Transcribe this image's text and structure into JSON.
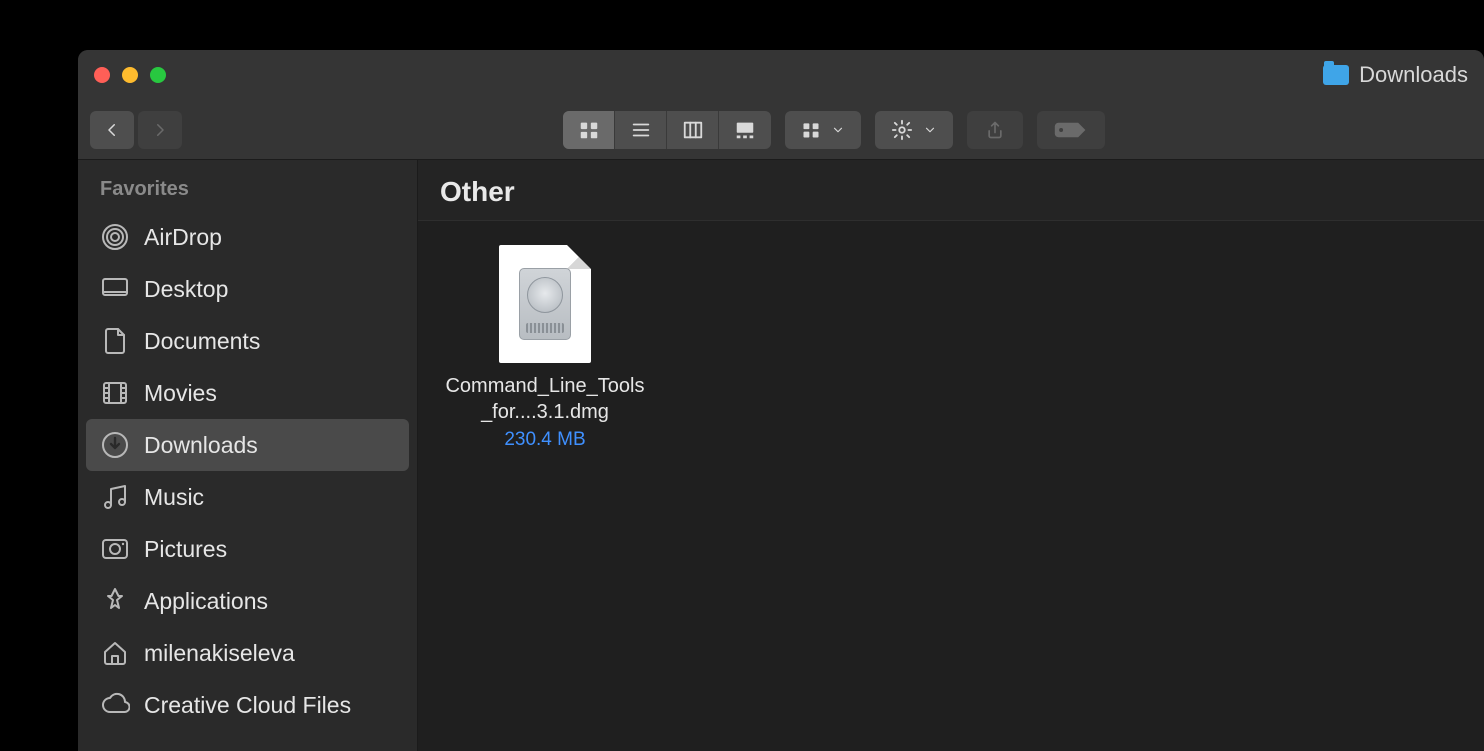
{
  "window": {
    "title": "Downloads"
  },
  "sidebar": {
    "heading": "Favorites",
    "items": [
      {
        "label": "AirDrop",
        "icon": "airdrop-icon",
        "selected": false
      },
      {
        "label": "Desktop",
        "icon": "desktop-icon",
        "selected": false
      },
      {
        "label": "Documents",
        "icon": "documents-icon",
        "selected": false
      },
      {
        "label": "Movies",
        "icon": "movies-icon",
        "selected": false
      },
      {
        "label": "Downloads",
        "icon": "downloads-icon",
        "selected": true
      },
      {
        "label": "Music",
        "icon": "music-icon",
        "selected": false
      },
      {
        "label": "Pictures",
        "icon": "pictures-icon",
        "selected": false
      },
      {
        "label": "Applications",
        "icon": "applications-icon",
        "selected": false
      },
      {
        "label": "milenakiseleva",
        "icon": "home-icon",
        "selected": false
      },
      {
        "label": "Creative Cloud Files",
        "icon": "creative-cloud-icon",
        "selected": false
      }
    ]
  },
  "main": {
    "group_header": "Other",
    "files": [
      {
        "name": "Command_Line_Tools_for....3.1.dmg",
        "size": "230.4 MB"
      }
    ]
  }
}
